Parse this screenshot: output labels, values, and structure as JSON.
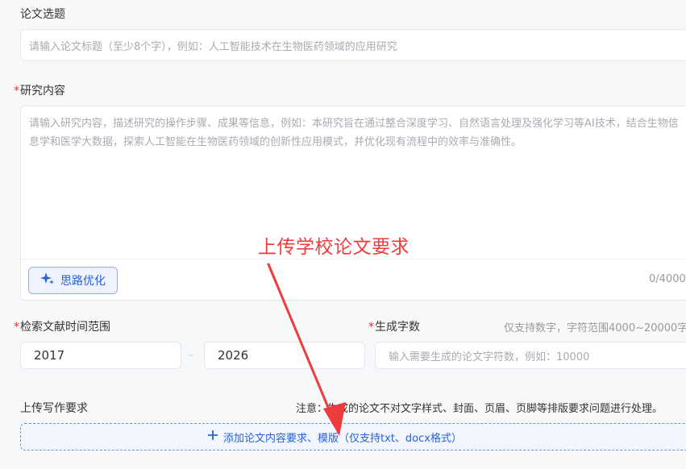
{
  "topic": {
    "label": "论文选题",
    "placeholder": "请输入论文标题（至少8个字），例如：人工智能技术在生物医药领域的应用研究"
  },
  "research": {
    "required_mark": "*",
    "label": "研究内容",
    "placeholder": "请输入研究内容，描述研究的操作步骤、成果等信息，例如：本研究旨在通过整合深度学习、自然语言处理及强化学习等AI技术，结合生物信息学和医学大数据，探索人工智能在生物医药领域的创新性应用模式，并优化现有流程中的效率与准确性。",
    "optimize_button": "思路优化",
    "counter": "0/4000"
  },
  "time_range": {
    "required_mark": "*",
    "label": "检索文献时间范围",
    "start_year": "2017",
    "separator": "–",
    "end_year": "2026"
  },
  "word_count": {
    "required_mark": "*",
    "label": "生成字数",
    "hint": "仅支持数字，字符范围4000~20000字",
    "placeholder": "输入需要生成的论文字符数，例如：10000"
  },
  "upload": {
    "label": "上传写作要求",
    "note": "注意：生成的论文不对文字样式、封面、页眉、页脚等排版要求问题进行处理。",
    "button": "添加论文内容要求、模版（仅支持txt、docx格式）"
  },
  "annotation": {
    "text": "上传学校论文要求",
    "color": "#ee3c3c"
  },
  "colors": {
    "accent": "#2861d8",
    "required": "#e4393c",
    "placeholder": "#a8abb2"
  }
}
